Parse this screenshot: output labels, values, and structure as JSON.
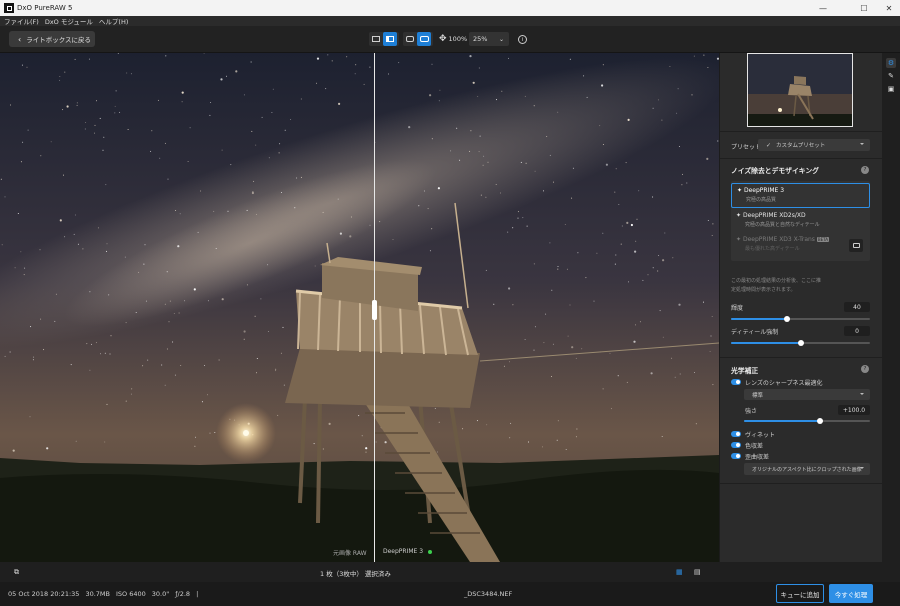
{
  "window": {
    "title": "DxO PureRAW 5",
    "minimize": "—",
    "maximize": "☐",
    "close": "✕"
  },
  "menu": [
    "ファイル(F)",
    "DxO モジュール",
    "ヘルプ(H)"
  ],
  "toolbar": {
    "back_label": "ライトボックスに戻る",
    "zoom_fit": "100%",
    "zoom_level": "25%"
  },
  "viewer": {
    "left_label": "元画像 RAW",
    "right_label": "DeepPRIME 3"
  },
  "panel": {
    "preset_label": "プリセット",
    "preset_value": "カスタムプリセット",
    "denoise_title": "ノイズ除去とデモザイキング",
    "methods": [
      {
        "name": "DeepPRIME 3",
        "desc": "究極の高品質",
        "selected": true,
        "enabled": true
      },
      {
        "name": "DeepPRIME XD2s/XD",
        "desc": "究極の高品質と自然なディテール",
        "selected": false,
        "enabled": true
      },
      {
        "name": "DeepPRIME XD3 X-Trans",
        "badge": "BETA",
        "desc": "最も優れた高ディテール",
        "selected": false,
        "enabled": false
      }
    ],
    "info_text_1": "この最初の処理結果の分析後、ここに推",
    "info_text_2": "定処理時間が表示されます。",
    "luminance_label": "輝度",
    "luminance_value": "40",
    "luminance_level": 0.4,
    "detail_label": "ディティール強制",
    "detail_value": "0",
    "detail_level": 0.5,
    "optics_title": "光学補正",
    "sharpness_label": "レンズのシャープネス最適化",
    "sharpness_mode": "標準",
    "strength_label": "強さ",
    "strength_value": "+100.0",
    "strength_level": 0.6,
    "vignetting_label": "ヴィネット",
    "ca_label": "色収差",
    "distortion_label": "歪曲収差",
    "distortion_option": "オリジナルのアスペクト比にクロップされた画像"
  },
  "bottom": {
    "selection": "1 枚（3枚中） 選択済み"
  },
  "status": {
    "date": "05 Oct 2018 20:21:35",
    "size": "30.7MB",
    "iso": "ISO 6400",
    "shutter": "30.0\"",
    "aperture": "ƒ/2.8",
    "sep": "|",
    "filename": "_DSC3484.NEF",
    "queue_button": "キューに追加",
    "process_button": "今すぐ処理"
  },
  "colors": {
    "accent": "#2e8fe6",
    "panel": "#2b2b2b",
    "status_dot": "#3ccf4e"
  },
  "icons": [
    "chevron-left-icon",
    "single-view-icon",
    "split-view-icon",
    "compare-single-icon",
    "compare-split-icon",
    "move-icon",
    "info-icon",
    "help-icon",
    "comment-icon",
    "copy-icon",
    "grid-view-icon",
    "filmstrip-view-icon",
    "denoise-tool-icon",
    "brush-tool-icon",
    "export-tool-icon"
  ]
}
